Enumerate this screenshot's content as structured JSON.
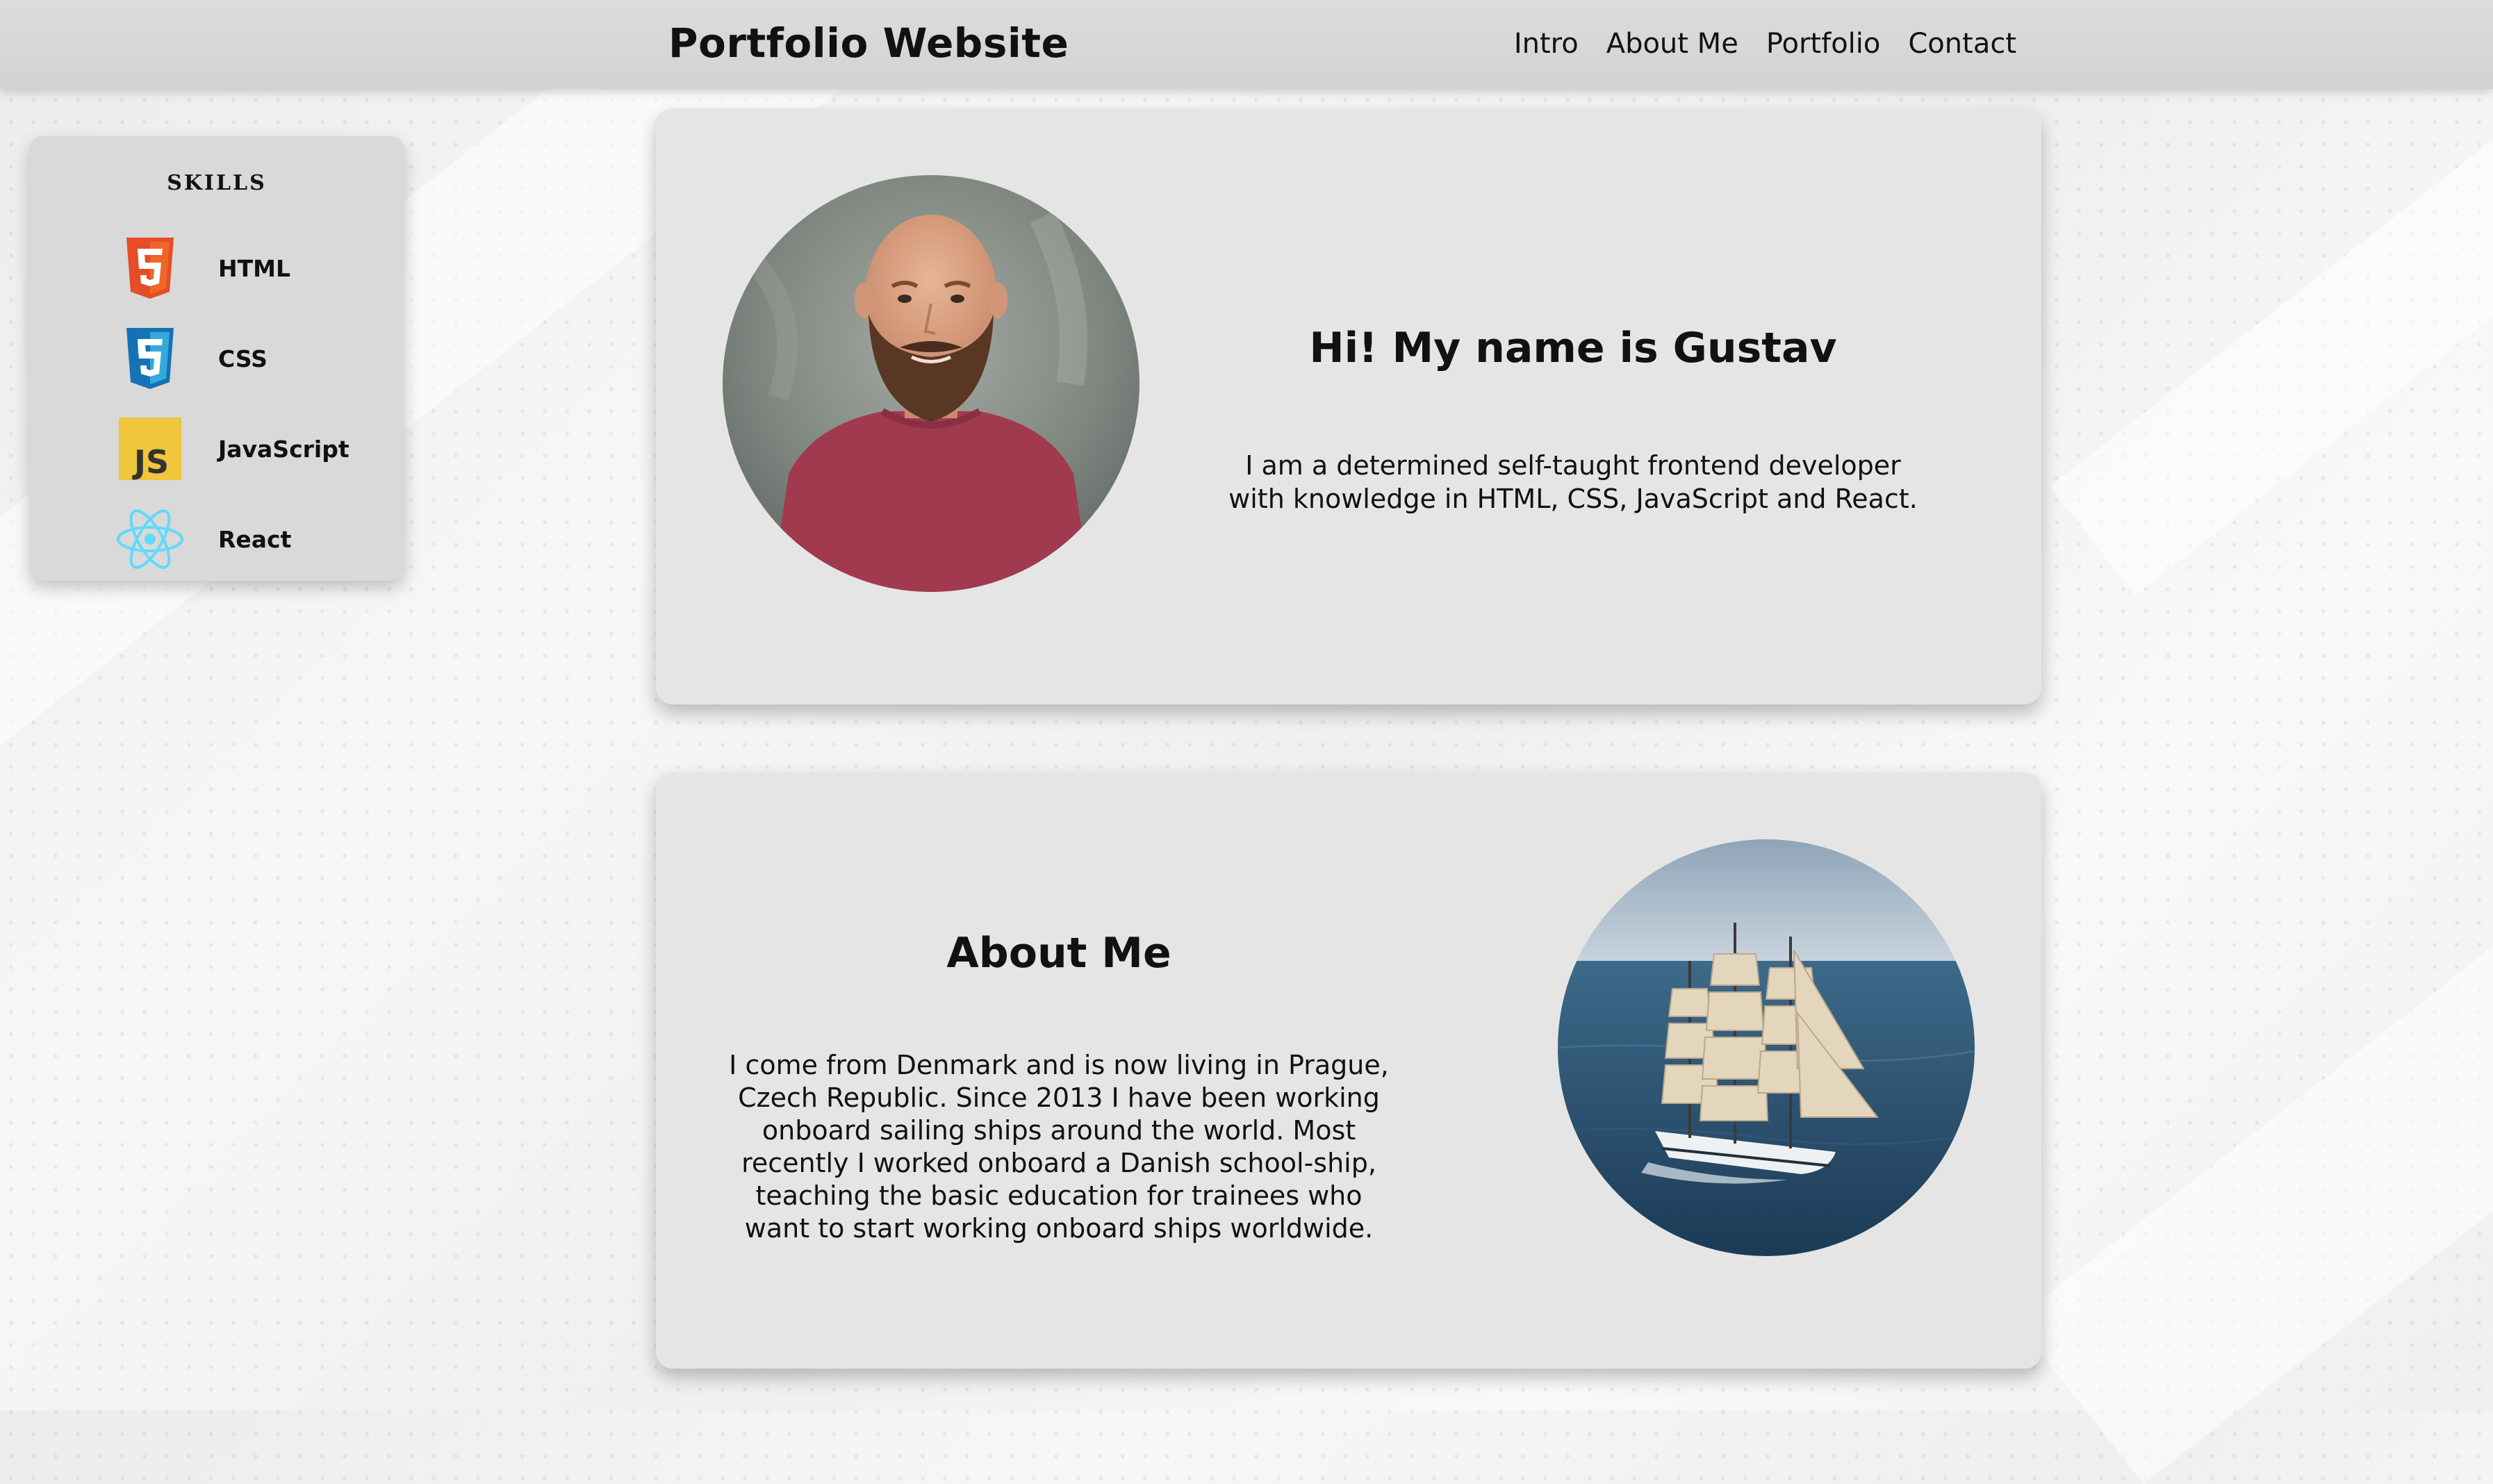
{
  "header": {
    "title": "Portfolio Website",
    "nav": [
      "Intro",
      "About Me",
      "Portfolio",
      "Contact"
    ]
  },
  "skills": {
    "title": "SKILLS",
    "items": [
      {
        "label": "HTML",
        "icon": "html5-icon",
        "color": "#e44d26"
      },
      {
        "label": "CSS",
        "icon": "css3-icon",
        "color": "#1572b6"
      },
      {
        "label": "JavaScript",
        "icon": "javascript-icon",
        "color": "#f0c63a"
      },
      {
        "label": "React",
        "icon": "react-icon",
        "color": "#61dafb"
      }
    ]
  },
  "intro": {
    "heading": "Hi! My name is Gustav",
    "text": "I am a determined self-taught frontend developer with knowledge in HTML, CSS, JavaScript and React."
  },
  "about": {
    "heading": "About Me",
    "text": "I come from Denmark and is now living in Prague, Czech Republic. Since 2013 I have been working onboard sailing ships around the world. Most recently I worked onboard a Danish school-ship, teaching the basic education for trainees who want to start working onboard ships worldwide."
  },
  "colors": {
    "header_bg": "#d6d6d6",
    "card_bg": "#e5e5e5",
    "panel_bg": "#d9d9d9"
  }
}
